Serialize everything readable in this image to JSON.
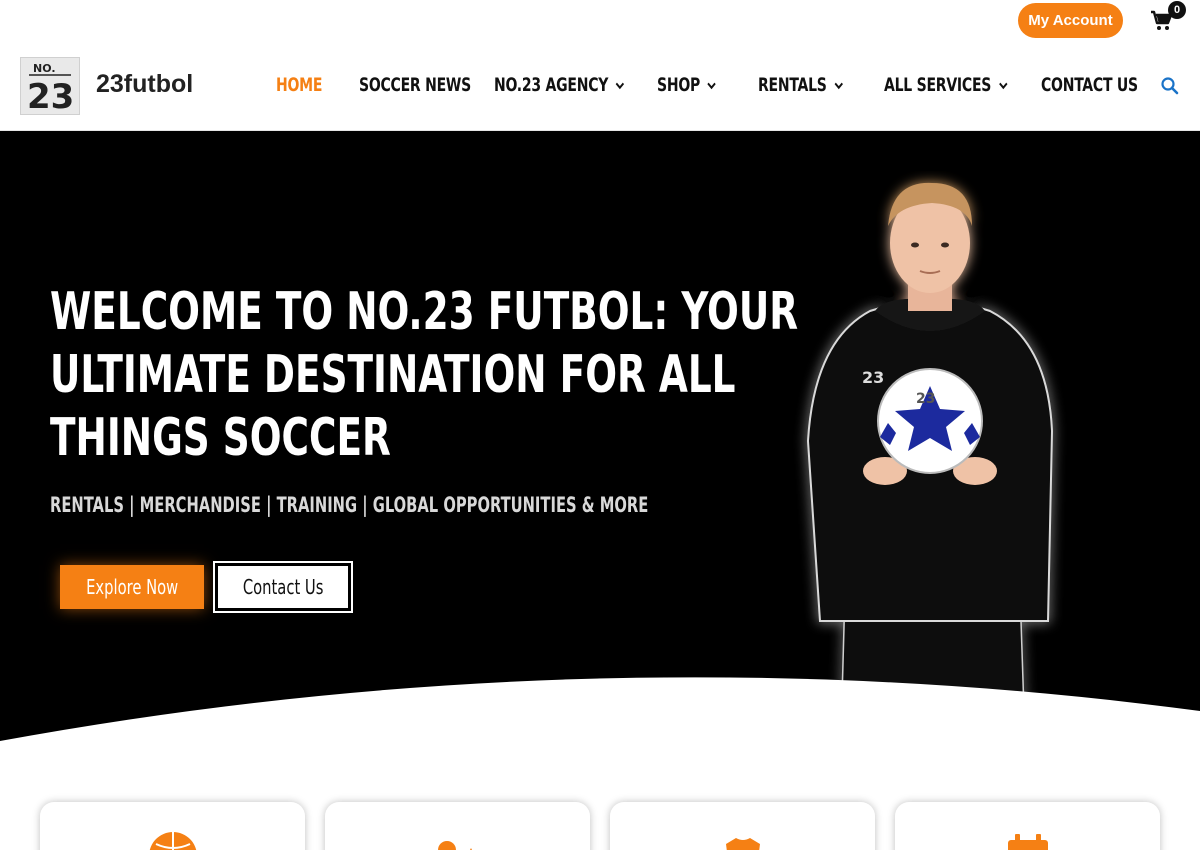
{
  "topbar": {
    "account_label": "My Account",
    "cart_count": "0"
  },
  "header": {
    "site_name": "23futbol",
    "logo_text_top": "NO.",
    "logo_text_num": "23",
    "nav": [
      {
        "label": "HOME",
        "active": true,
        "dropdown": false
      },
      {
        "label": "SOCCER NEWS",
        "active": false,
        "dropdown": false
      },
      {
        "label": "NO.23 AGENCY",
        "active": false,
        "dropdown": true
      },
      {
        "label": "SHOP",
        "active": false,
        "dropdown": true
      },
      {
        "label": "RENTALS",
        "active": false,
        "dropdown": true
      },
      {
        "label": "ALL SERVICES",
        "active": false,
        "dropdown": true
      },
      {
        "label": "CONTACT US",
        "active": false,
        "dropdown": false
      }
    ]
  },
  "hero": {
    "title": "Welcome to No.23 Futbol: Your Ultimate Destination for All Things Soccer",
    "subtitle": "RENTALS | MERCHANDISE | TRAINING | GLOBAL OPPORTUNITIES & MORE",
    "explore_label": "Explore Now",
    "contact_label": "Contact Us"
  },
  "cards": [
    {
      "icon": "soccer-ball-icon"
    },
    {
      "icon": "training-player-icon"
    },
    {
      "icon": "jersey-icon"
    },
    {
      "icon": "calendar-icon"
    }
  ],
  "colors": {
    "accent": "#f58014",
    "hero_bg": "#000000",
    "link_blue": "#1a73c8"
  }
}
